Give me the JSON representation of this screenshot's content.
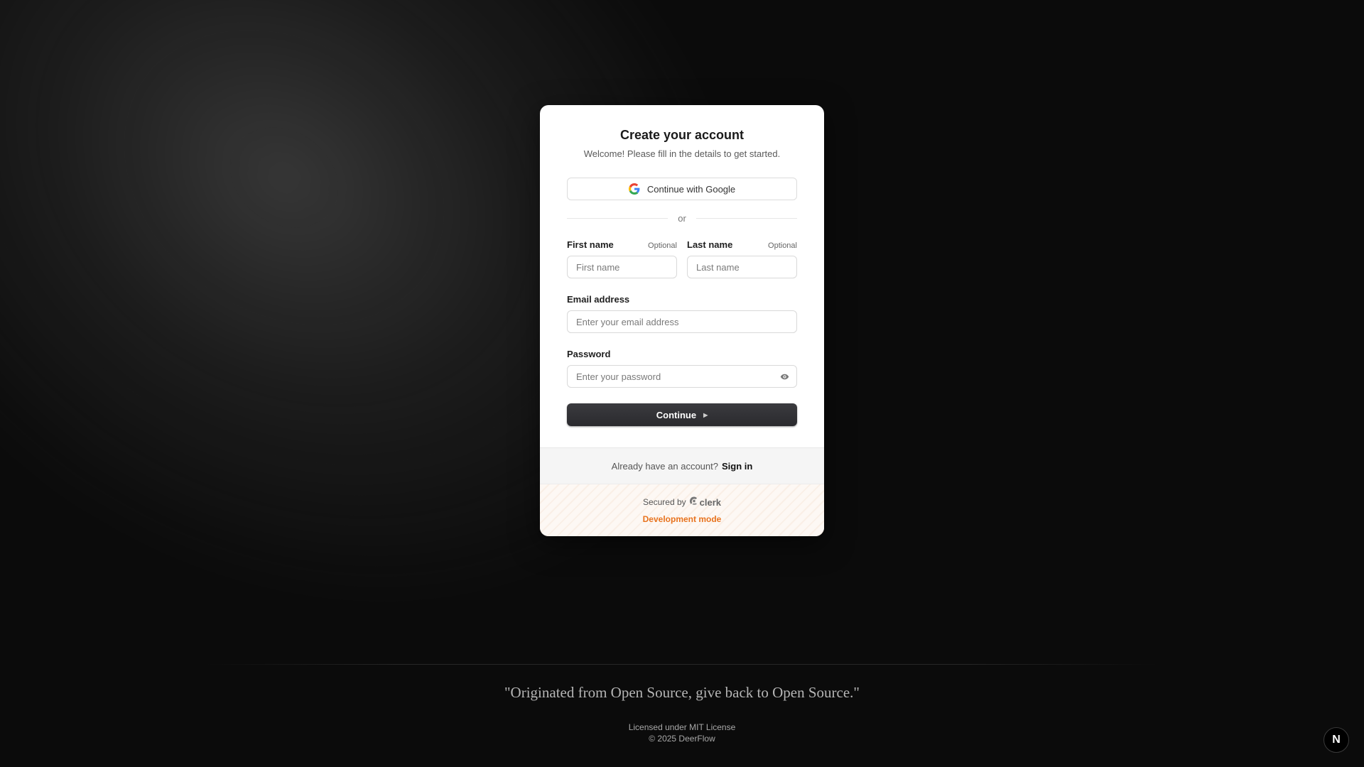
{
  "card": {
    "title": "Create your account",
    "subtitle": "Welcome! Please fill in the details to get started.",
    "google_button": "Continue with Google",
    "divider_text": "or",
    "first_name": {
      "label": "First name",
      "optional": "Optional",
      "placeholder": "First name"
    },
    "last_name": {
      "label": "Last name",
      "optional": "Optional",
      "placeholder": "Last name"
    },
    "email": {
      "label": "Email address",
      "placeholder": "Enter your email address"
    },
    "password": {
      "label": "Password",
      "placeholder": "Enter your password"
    },
    "continue_button": "Continue",
    "footer_prompt": "Already have an account?",
    "footer_link": "Sign in",
    "secured_by": "Secured by",
    "clerk_brand": "clerk",
    "dev_mode": "Development mode"
  },
  "page": {
    "quote": "\"Originated from Open Source, give back to Open Source.\"",
    "license": "Licensed under MIT License",
    "copyright": "© 2025 DeerFlow",
    "badge": "N"
  },
  "colors": {
    "background": "#0b0b0b",
    "dev_mode": "#e8731e",
    "button": "#2f2f33"
  },
  "icons": [
    "google-icon",
    "eye-icon",
    "caret-right-icon",
    "clerk-logo-icon",
    "nextjs-icon"
  ]
}
